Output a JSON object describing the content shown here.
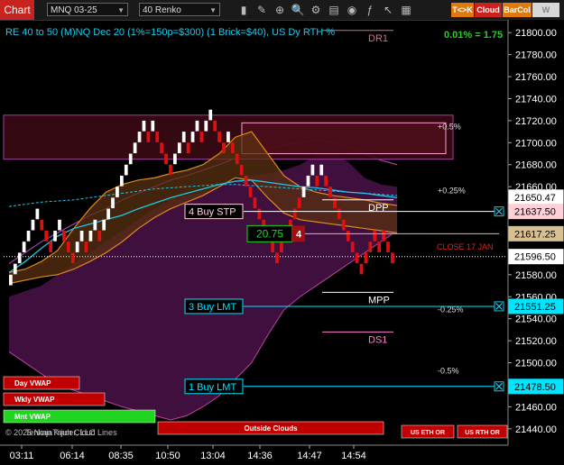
{
  "toolbar": {
    "title": "Chart",
    "instrument": "MNQ 03-25",
    "bar_type": "40 Renko",
    "icons": [
      "bar-chart-icon",
      "pencil-icon",
      "magnifier-icon",
      "zoom-icon",
      "properties-icon",
      "template-icon",
      "strategy-icon",
      "indicator-icon",
      "cursor-icon",
      "data-box-icon"
    ],
    "buttons": [
      {
        "label": "T<>K",
        "bg": "#e07a10",
        "fg": "#ffffff"
      },
      {
        "label": "Cloud",
        "bg": "#c8231e",
        "fg": "#ffffff"
      },
      {
        "label": "BarCol",
        "bg": "#e07a10",
        "fg": "#ffffff"
      },
      {
        "label": "W VWAP",
        "bg": "#d8d8d8",
        "fg": "#888888"
      }
    ]
  },
  "colors": {
    "bull": "#ffffff",
    "bear": "#e01010",
    "cyan": "#1ec8e6",
    "orange": "#e08a1e",
    "purple": "#a040a0",
    "magenta": "#ff7fd0",
    "green": "#21d421",
    "price_axis_bg": "#000000"
  },
  "chart_data": {
    "type": "line",
    "title": "RE 40 to 50 (M)NQ Dec 20 (1%=150p=$300) (1 Brick=$40), US Dy RTH %",
    "performance": "0.01% = 1.75",
    "y_range": [
      21430,
      21810
    ],
    "y_ticks": [
      21440,
      21460,
      21480,
      21500,
      21520,
      21540,
      21560,
      21580,
      21600,
      21620,
      21640,
      21660,
      21680,
      21700,
      21720,
      21740,
      21760,
      21780,
      21800
    ],
    "x_tick_labels": [
      "03:11",
      "06:14",
      "08:35",
      "10:50",
      "13:04",
      "14:36",
      "14:47",
      "14:54"
    ],
    "bricks": [
      {
        "y0": 21570,
        "y1": 21580,
        "dir": "up",
        "bull": true
      },
      {
        "y0": 21580,
        "y1": 21590,
        "dir": "up",
        "bull": true
      },
      {
        "y0": 21590,
        "y1": 21600,
        "dir": "up",
        "bull": true
      },
      {
        "y0": 21600,
        "y1": 21610,
        "dir": "up",
        "bull": true
      },
      {
        "y0": 21610,
        "y1": 21620,
        "dir": "up",
        "bull": true
      },
      {
        "y0": 21620,
        "y1": 21630,
        "dir": "up",
        "bull": true
      },
      {
        "y0": 21630,
        "y1": 21640,
        "dir": "up",
        "bull": true
      },
      {
        "y0": 21620,
        "y1": 21630,
        "dir": "down",
        "bull": false
      },
      {
        "y0": 21610,
        "y1": 21620,
        "dir": "down",
        "bull": false
      },
      {
        "y0": 21600,
        "y1": 21610,
        "dir": "down",
        "bull": false
      },
      {
        "y0": 21610,
        "y1": 21620,
        "dir": "up",
        "bull": true
      },
      {
        "y0": 21620,
        "y1": 21630,
        "dir": "up",
        "bull": true
      },
      {
        "y0": 21610,
        "y1": 21620,
        "dir": "down",
        "bull": false
      },
      {
        "y0": 21600,
        "y1": 21610,
        "dir": "down",
        "bull": false
      },
      {
        "y0": 21590,
        "y1": 21600,
        "dir": "down",
        "bull": false
      },
      {
        "y0": 21600,
        "y1": 21610,
        "dir": "up",
        "bull": true
      },
      {
        "y0": 21610,
        "y1": 21620,
        "dir": "up",
        "bull": true
      },
      {
        "y0": 21600,
        "y1": 21610,
        "dir": "down",
        "bull": false
      },
      {
        "y0": 21610,
        "y1": 21620,
        "dir": "up",
        "bull": true
      },
      {
        "y0": 21620,
        "y1": 21630,
        "dir": "up",
        "bull": true
      },
      {
        "y0": 21610,
        "y1": 21620,
        "dir": "down",
        "bull": false
      },
      {
        "y0": 21620,
        "y1": 21630,
        "dir": "up",
        "bull": true
      },
      {
        "y0": 21630,
        "y1": 21640,
        "dir": "up",
        "bull": true
      },
      {
        "y0": 21640,
        "y1": 21650,
        "dir": "up",
        "bull": true
      },
      {
        "y0": 21650,
        "y1": 21660,
        "dir": "up",
        "bull": true
      },
      {
        "y0": 21660,
        "y1": 21670,
        "dir": "up",
        "bull": true
      },
      {
        "y0": 21670,
        "y1": 21680,
        "dir": "up",
        "bull": true
      },
      {
        "y0": 21680,
        "y1": 21690,
        "dir": "up",
        "bull": true
      },
      {
        "y0": 21690,
        "y1": 21700,
        "dir": "up",
        "bull": true
      },
      {
        "y0": 21700,
        "y1": 21710,
        "dir": "up",
        "bull": true
      },
      {
        "y0": 21710,
        "y1": 21720,
        "dir": "up",
        "bull": true
      },
      {
        "y0": 21700,
        "y1": 21710,
        "dir": "down",
        "bull": false
      },
      {
        "y0": 21710,
        "y1": 21720,
        "dir": "up",
        "bull": true
      },
      {
        "y0": 21700,
        "y1": 21710,
        "dir": "down",
        "bull": false
      },
      {
        "y0": 21690,
        "y1": 21700,
        "dir": "down",
        "bull": false
      },
      {
        "y0": 21680,
        "y1": 21690,
        "dir": "down",
        "bull": false
      },
      {
        "y0": 21670,
        "y1": 21680,
        "dir": "down",
        "bull": false
      },
      {
        "y0": 21680,
        "y1": 21690,
        "dir": "up",
        "bull": true
      },
      {
        "y0": 21690,
        "y1": 21700,
        "dir": "up",
        "bull": true
      },
      {
        "y0": 21700,
        "y1": 21710,
        "dir": "up",
        "bull": true
      },
      {
        "y0": 21690,
        "y1": 21700,
        "dir": "down",
        "bull": false
      },
      {
        "y0": 21700,
        "y1": 21710,
        "dir": "up",
        "bull": true
      },
      {
        "y0": 21710,
        "y1": 21720,
        "dir": "up",
        "bull": true
      },
      {
        "y0": 21700,
        "y1": 21710,
        "dir": "down",
        "bull": false
      },
      {
        "y0": 21710,
        "y1": 21720,
        "dir": "up",
        "bull": true
      },
      {
        "y0": 21720,
        "y1": 21730,
        "dir": "up",
        "bull": true
      },
      {
        "y0": 21710,
        "y1": 21720,
        "dir": "down",
        "bull": false
      },
      {
        "y0": 21700,
        "y1": 21710,
        "dir": "down",
        "bull": false
      },
      {
        "y0": 21690,
        "y1": 21700,
        "dir": "down",
        "bull": false
      },
      {
        "y0": 21700,
        "y1": 21710,
        "dir": "up",
        "bull": true
      },
      {
        "y0": 21690,
        "y1": 21700,
        "dir": "down",
        "bull": false
      },
      {
        "y0": 21680,
        "y1": 21690,
        "dir": "down",
        "bull": false
      },
      {
        "y0": 21670,
        "y1": 21680,
        "dir": "down",
        "bull": false
      },
      {
        "y0": 21660,
        "y1": 21670,
        "dir": "down",
        "bull": false
      },
      {
        "y0": 21650,
        "y1": 21660,
        "dir": "down",
        "bull": false
      },
      {
        "y0": 21640,
        "y1": 21650,
        "dir": "down",
        "bull": false
      },
      {
        "y0": 21630,
        "y1": 21640,
        "dir": "down",
        "bull": false
      },
      {
        "y0": 21620,
        "y1": 21630,
        "dir": "down",
        "bull": false
      },
      {
        "y0": 21610,
        "y1": 21620,
        "dir": "down",
        "bull": false
      },
      {
        "y0": 21600,
        "y1": 21610,
        "dir": "down",
        "bull": false
      },
      {
        "y0": 21590,
        "y1": 21600,
        "dir": "down",
        "bull": false
      },
      {
        "y0": 21600,
        "y1": 21610,
        "dir": "up",
        "bull": false
      },
      {
        "y0": 21610,
        "y1": 21620,
        "dir": "up",
        "bull": false
      },
      {
        "y0": 21620,
        "y1": 21630,
        "dir": "up",
        "bull": false
      },
      {
        "y0": 21630,
        "y1": 21640,
        "dir": "up",
        "bull": false
      },
      {
        "y0": 21640,
        "y1": 21650,
        "dir": "up",
        "bull": false
      },
      {
        "y0": 21650,
        "y1": 21660,
        "dir": "up",
        "bull": true
      },
      {
        "y0": 21660,
        "y1": 21670,
        "dir": "up",
        "bull": true
      },
      {
        "y0": 21670,
        "y1": 21680,
        "dir": "up",
        "bull": true
      },
      {
        "y0": 21660,
        "y1": 21670,
        "dir": "down",
        "bull": false
      },
      {
        "y0": 21670,
        "y1": 21680,
        "dir": "up",
        "bull": true
      },
      {
        "y0": 21660,
        "y1": 21670,
        "dir": "down",
        "bull": false
      },
      {
        "y0": 21650,
        "y1": 21660,
        "dir": "down",
        "bull": false
      },
      {
        "y0": 21640,
        "y1": 21650,
        "dir": "down",
        "bull": false
      },
      {
        "y0": 21630,
        "y1": 21640,
        "dir": "down",
        "bull": false
      },
      {
        "y0": 21620,
        "y1": 21630,
        "dir": "down",
        "bull": false
      },
      {
        "y0": 21610,
        "y1": 21620,
        "dir": "down",
        "bull": false
      },
      {
        "y0": 21600,
        "y1": 21610,
        "dir": "down",
        "bull": false
      },
      {
        "y0": 21590,
        "y1": 21600,
        "dir": "down",
        "bull": false
      },
      {
        "y0": 21580,
        "y1": 21590,
        "dir": "down",
        "bull": false
      },
      {
        "y0": 21590,
        "y1": 21600,
        "dir": "up",
        "bull": false
      },
      {
        "y0": 21600,
        "y1": 21610,
        "dir": "up",
        "bull": false
      },
      {
        "y0": 21610,
        "y1": 21620,
        "dir": "up",
        "bull": false
      },
      {
        "y0": 21600,
        "y1": 21610,
        "dir": "down",
        "bull": false
      },
      {
        "y0": 21610,
        "y1": 21620,
        "dir": "up",
        "bull": false
      },
      {
        "y0": 21600,
        "y1": 21610,
        "dir": "down",
        "bull": false
      },
      {
        "y0": 21590,
        "y1": 21600,
        "dir": "down",
        "bull": false
      }
    ],
    "cyan_ma": [
      21582,
      21592,
      21604,
      21615,
      21622,
      21626,
      21630,
      21634,
      21640,
      21645,
      21650,
      21654,
      21658,
      21662,
      21665,
      21666,
      21664,
      21662,
      21660,
      21659,
      21657,
      21655,
      21654,
      21652,
      21650
    ],
    "cyan_dashed_vwap": [
      21642,
      21644,
      21646,
      21647,
      21648,
      21650,
      21652,
      21654,
      21656,
      21658,
      21659,
      21660,
      21661,
      21662,
      21662,
      21661,
      21660,
      21659,
      21658,
      21657,
      21656,
      21655,
      21654,
      21653,
      21652
    ],
    "orange_upper": [
      21582,
      21585,
      21592,
      21602,
      21622,
      21640,
      21655,
      21662,
      21666,
      21668,
      21672,
      21675,
      21680,
      21690,
      21705,
      21710,
      21690,
      21670,
      21660,
      21655,
      21652,
      21650,
      21648,
      21645,
      21643
    ],
    "orange_lower": [
      21572,
      21575,
      21578,
      21580,
      21585,
      21592,
      21600,
      21610,
      21622,
      21632,
      21640,
      21646,
      21652,
      21660,
      21668,
      21666,
      21650,
      21636,
      21630,
      21628,
      21626,
      21624,
      21622,
      21620,
      21618
    ],
    "cloud_upper": [
      21560,
      21565,
      21570,
      21580,
      21590,
      21600,
      21610,
      21620,
      21630,
      21640,
      21648,
      21652,
      21655,
      21660,
      21666,
      21670,
      21672,
      21675,
      21680,
      21688,
      21692,
      21682,
      21668,
      21662,
      21660
    ],
    "cloud_lower": [
      21510,
      21500,
      21490,
      21480,
      21475,
      21470,
      21465,
      21460,
      21456,
      21452,
      21448,
      21452,
      21460,
      21470,
      21485,
      21500,
      21525,
      21548,
      21560,
      21570,
      21580,
      21590,
      21600,
      21610,
      21620
    ],
    "extra_purple_line": [
      21590,
      21600,
      21610,
      21618,
      21626,
      21634,
      21640,
      21648,
      21654,
      21660,
      21666,
      21670,
      21675,
      21680,
      21686,
      21690,
      21694,
      21698,
      21700,
      21702,
      21700,
      21696,
      21690,
      21684,
      21680
    ],
    "rects": [
      {
        "name": "resistance-zone",
        "y_top": 21725,
        "y_bottom": 21685,
        "fill": "#3a0a14",
        "stroke": "#a040a0"
      },
      {
        "name": "target-zone",
        "y_top": 21718,
        "y_bottom": 21690,
        "fill": "#5a1020",
        "stroke": "#ff9fd0"
      }
    ],
    "levels": [
      {
        "name": "dr1",
        "label": "DR1",
        "price": 21802,
        "color": "#d07090"
      },
      {
        "name": "dpp",
        "label": "DPP",
        "price": 21648,
        "color": "#ffffff"
      },
      {
        "name": "mpp",
        "label": "MPP",
        "price": 21564,
        "color": "#ffffff"
      },
      {
        "name": "ds1",
        "label": "DS1",
        "price": 21528,
        "color": "#ff7fd0"
      }
    ],
    "pct_labels": [
      {
        "label": "+0.5%",
        "price": 21712
      },
      {
        "label": "+0.25%",
        "price": 21654
      },
      {
        "label": "-0.25%",
        "price": 21546
      },
      {
        "label": "-0.5%",
        "price": 21490
      }
    ],
    "close_label": {
      "label": "CLOSE 17 JAN",
      "price": 21606
    },
    "close_line": 21596.5,
    "orders": [
      {
        "name": "buy-stp-order",
        "label": "4 Buy STP",
        "price": 21637.5,
        "color": "#ffd0d8",
        "line": "#ffffff"
      },
      {
        "name": "buy-lmt-3-order",
        "label": "3 Buy LMT",
        "price": 21551.25,
        "color": "#00e5ff",
        "line": "#00e5ff"
      },
      {
        "name": "buy-lmt-1-order",
        "label": "1 Buy LMT",
        "price": 21478.5,
        "color": "#00e5ff",
        "line": "#00e5ff"
      }
    ],
    "position": {
      "price": 21617.25,
      "pnl_value": "20.75",
      "qty": "4"
    },
    "price_tags": [
      {
        "value": "21650.47",
        "price": 21650.47,
        "bg": "#ffffff",
        "fg": "#000000",
        "border": "#ffffff"
      },
      {
        "value": "21637.50",
        "price": 21637.5,
        "bg": "#ffd0d8",
        "fg": "#000000",
        "border": "#ffd0d8"
      },
      {
        "value": "21617.25",
        "price": 21617.25,
        "bg": "#d8c090",
        "fg": "#000000",
        "border": "#d8c090"
      },
      {
        "value": "21596.50",
        "price": 21596.5,
        "bg": "#ffffff",
        "fg": "#000000",
        "border": "#ffffff"
      },
      {
        "value": "21551.25",
        "price": 21551.25,
        "bg": "#00e5ff",
        "fg": "#000000",
        "border": "#00e5ff"
      },
      {
        "value": "21478.50",
        "price": 21478.5,
        "bg": "#00e5ff",
        "fg": "#000000",
        "border": "#00e5ff"
      }
    ],
    "legend_buttons": [
      {
        "name": "day-vwap-button",
        "label": "Day VWAP",
        "bg": "#c00000"
      },
      {
        "name": "wkly-vwap-button",
        "label": "Wkly VWAP",
        "bg": "#c00000"
      },
      {
        "name": "mnt-vwap-button",
        "label": "Mnt VWAP",
        "bg": "#21d421"
      },
      {
        "name": "outside-clouds-button",
        "label": "Outside Clouds",
        "bg": "#c00000"
      },
      {
        "name": "us-eth-or-button",
        "label": "US ETH OR",
        "bg": "#c00000"
      },
      {
        "name": "us-rth-or-button",
        "label": "US RTH OR",
        "bg": "#c00000"
      }
    ],
    "copyright": "© 2025 NinjaTrader, LLC",
    "source_label": "Tenkan Kijun Cloud Lines"
  }
}
